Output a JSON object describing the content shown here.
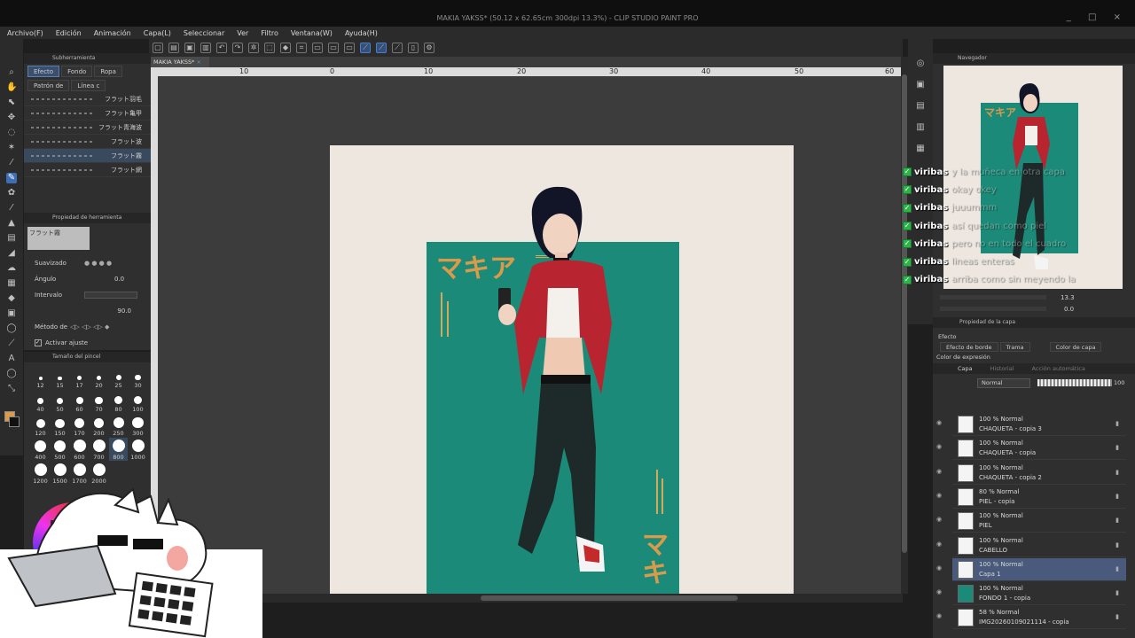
{
  "window": {
    "title": "MAKIA YAKSS* (50.12 x 62.65cm 300dpi 13.3%) - CLIP STUDIO PAINT PRO",
    "controls": [
      "_",
      "□",
      "×"
    ]
  },
  "menu": [
    "Archivo(F)",
    "Edición",
    "Animación",
    "Capa(L)",
    "Seleccionar",
    "Ver",
    "Filtro",
    "Ventana(W)",
    "Ayuda(H)"
  ],
  "subtool": {
    "panel_title": "Subherramienta",
    "tabs": [
      "Efecto",
      "Fondo",
      "Ropa",
      "Patrón de",
      "Línea c"
    ],
    "brushes": [
      "フラット羽毛",
      "フラット亀甲",
      "フラット青海波",
      "フラット波",
      "フラット霧",
      "フラット網"
    ]
  },
  "tool_property": {
    "title": "Propiedad de herramienta",
    "brush_name": "フラット霧",
    "suavizado_label": "Suavizado",
    "angulo_label": "Ángulo",
    "angulo_value": "0.0",
    "intervalo_label": "Intervalo",
    "intervalo_value": "90.0",
    "metodo_label": "Método de",
    "activar_label": "Activar ajuste"
  },
  "brush_size": {
    "title": "Tamaño del pincel",
    "sizes": [
      "12",
      "15",
      "17",
      "20",
      "25",
      "30",
      "40",
      "50",
      "60",
      "70",
      "80",
      "100",
      "120",
      "150",
      "170",
      "200",
      "250",
      "300",
      "400",
      "500",
      "600",
      "700",
      "800",
      "1000",
      "1200",
      "1500",
      "1700",
      "2000"
    ],
    "selected": "800"
  },
  "canvas": {
    "doc_tab": "MAKIA YAKSS*",
    "ruler_marks": [
      "10",
      "0",
      "10",
      "20",
      "30",
      "40",
      "50",
      "60"
    ],
    "artwork": {
      "kana_top": "マキア",
      "kana_side": "マキ"
    }
  },
  "navigator": {
    "title": "Navegador",
    "zoom": "13.3",
    "angle": "0.0"
  },
  "chat": [
    {
      "user": "viribas",
      "msg": "y la muñeca en otra capa"
    },
    {
      "user": "viribas",
      "msg": "okay okey"
    },
    {
      "user": "viribas",
      "msg": "juuummm"
    },
    {
      "user": "viribas",
      "msg": "así quedan como piel"
    },
    {
      "user": "viribas",
      "msg": "pero no en todo el cuadro"
    },
    {
      "user": "viribas",
      "msg": "lineas enteras"
    },
    {
      "user": "viribas",
      "msg": "arriba como sin meyendo la"
    }
  ],
  "layer_property": {
    "title": "Propiedad de la capa",
    "efecto_label": "Efecto",
    "effects": [
      "Efecto de borde",
      "Trama",
      "Color de capa"
    ],
    "color_expr": "Color de expresión"
  },
  "layers": {
    "tabs": [
      "Capa",
      "Historial",
      "Acción automática"
    ],
    "blend_mode": "Normal",
    "opacity": "100",
    "items": [
      {
        "mode": "100 % Normal",
        "name": "CHAQUETA - copia 3"
      },
      {
        "mode": "100 % Normal",
        "name": "CHAQUETA - copia"
      },
      {
        "mode": "100 % Normal",
        "name": "CHAQUETA - copia 2"
      },
      {
        "mode": "80 % Normal",
        "name": "PIEL - copia"
      },
      {
        "mode": "100 % Normal",
        "name": "PIEL"
      },
      {
        "mode": "100 % Normal",
        "name": "CABELLO"
      },
      {
        "mode": "100 % Normal",
        "name": "Capa 1"
      },
      {
        "mode": "100 % Normal",
        "name": "FONDO 1 - copia"
      },
      {
        "mode": "58 % Normal",
        "name": "IMG20260109021114 - copia"
      }
    ],
    "selected_index": 6
  },
  "colors": {
    "teal": "#1c8a78",
    "paper": "#ede7df",
    "accent_blue": "#3d6fb4",
    "jacket_red": "#b82430",
    "kana_orange": "#d99b4a"
  }
}
